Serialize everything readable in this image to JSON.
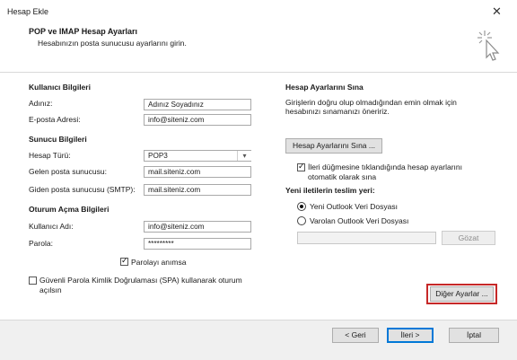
{
  "window": {
    "title": "Hesap Ekle",
    "close_glyph": "✕"
  },
  "header": {
    "title": "POP ve IMAP Hesap Ayarları",
    "subtitle": "Hesabınızın posta sunucusu ayarlarını girin.",
    "icon": "wizard-cursor-icon"
  },
  "left": {
    "user_info_heading": "Kullanıcı Bilgileri",
    "name_label": "Adınız:",
    "name_value": "Adınız Soyadınız",
    "email_label": "E-posta Adresi:",
    "email_value": "info@siteniz.com",
    "server_info_heading": "Sunucu Bilgileri",
    "account_type_label": "Hesap Türü:",
    "account_type_value": "POP3",
    "incoming_label": "Gelen posta sunucusu:",
    "incoming_value": "mail.siteniz.com",
    "outgoing_label": "Giden posta sunucusu (SMTP):",
    "outgoing_value": "mail.siteniz.com",
    "logon_heading": "Oturum Açma Bilgileri",
    "username_label": "Kullanıcı Adı:",
    "username_value": "info@siteniz.com",
    "password_label": "Parola:",
    "password_value": "*********",
    "remember_password_label": "Parolayı anımsa",
    "remember_password_checked": true,
    "spa_label_line1": "Güvenli Parola Kimlik Doğrulaması (SPA) kullanarak oturum",
    "spa_label_line2": "açılsın",
    "spa_checked": false
  },
  "right": {
    "test_heading": "Hesap Ayarlarını Sına",
    "test_desc_line1": "Girişlerin doğru olup olmadığından emin olmak için",
    "test_desc_line2": "hesabınızı sınamanızı öneririz.",
    "test_button": "Hesap Ayarlarını Sına ...",
    "auto_test_line1": "İleri düğmesine tıklandığında hesap ayarlarını",
    "auto_test_line2": "otomatik olarak sına",
    "auto_test_checked": true,
    "deliver_heading": "Yeni iletilerin teslim yeri:",
    "radio_new": "Yeni Outlook Veri Dosyası",
    "radio_existing": "Varolan Outlook Veri Dosyası",
    "selected_radio": "new",
    "browse_button": "Gözat",
    "more_settings_button": "Diğer Ayarlar ...",
    "highlight_color": "#c62828"
  },
  "footer": {
    "back_button": "< Geri",
    "next_button": "İleri >",
    "cancel_button": "İptal"
  }
}
